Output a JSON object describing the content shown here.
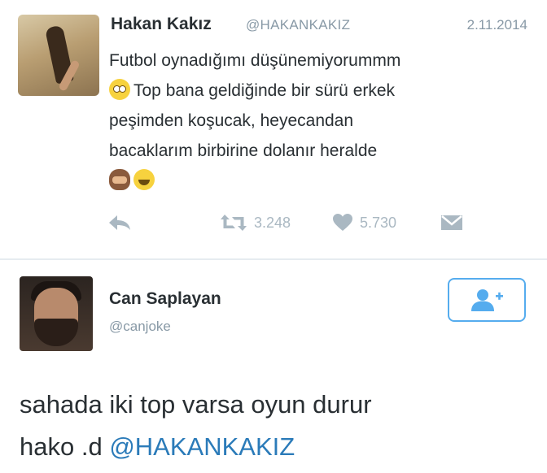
{
  "tweet": {
    "author_name": "Hakan Kakız",
    "author_handle": "@HAKANKAKIZ",
    "date": "2.11.2014",
    "lines": [
      "Futbol oynadığımı düşünemiyorummm",
      "Top bana geldiğinde bir sürü erkek",
      "peşimden koşucak, heyecandan",
      "bacaklarım birbirine dolanır heralde"
    ],
    "emoji_icons": [
      "flushed-face-icon",
      "see-no-evil-monkey-icon",
      "smiling-face-icon"
    ],
    "retweet_count": "3.248",
    "like_count": "5.730"
  },
  "reply": {
    "author_name": "Can Saplayan",
    "author_handle": "@canjoke",
    "line1": "sahada iki top varsa oyun durur",
    "line2_text": "hako .d",
    "mention": "@HAKANKAKIZ"
  },
  "colors": {
    "text": "#292f33",
    "muted": "#8899a6",
    "action": "#aab8c2",
    "accent": "#55acee",
    "mention": "#2b7bb9"
  }
}
